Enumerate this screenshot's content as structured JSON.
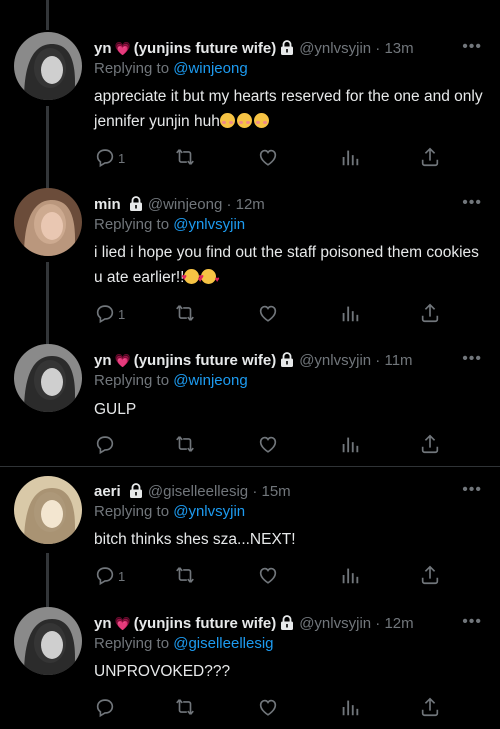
{
  "tweets": [
    {
      "name": "yn",
      "display_suffix": "(yunjins future wife)",
      "has_heart": true,
      "handle": "@ynlvsyjin",
      "time": "13m",
      "replying_prefix": "Replying to",
      "replying_to": "@winjeong",
      "text": "appreciate it but my hearts reserved for the one and only jennifer yunjin huh",
      "emojis": [
        "blush",
        "blush",
        "blush"
      ],
      "reply_count": "1"
    },
    {
      "name": "min",
      "display_suffix": "",
      "has_heart": false,
      "handle": "@winjeong",
      "time": "12m",
      "replying_prefix": "Replying to",
      "replying_to": "@ynlvsyjin",
      "text": "i lied i hope you find out the staff poisoned them cookies u ate earlier!!",
      "emojis": [
        "love",
        "love"
      ],
      "reply_count": "1"
    },
    {
      "name": "yn",
      "display_suffix": "(yunjins future wife)",
      "has_heart": true,
      "handle": "@ynlvsyjin",
      "time": "11m",
      "replying_prefix": "Replying to",
      "replying_to": "@winjeong",
      "text": "GULP",
      "emojis": [],
      "reply_count": ""
    },
    {
      "name": "aeri",
      "display_suffix": "",
      "has_heart": false,
      "handle": "@giselleellesig",
      "time": "15m",
      "replying_prefix": "Replying to",
      "replying_to": "@ynlvsyjin",
      "text": "bitch thinks shes sza...NEXT!",
      "emojis": [],
      "reply_count": "1"
    },
    {
      "name": "yn",
      "display_suffix": "(yunjins future wife)",
      "has_heart": true,
      "handle": "@ynlvsyjin",
      "time": "12m",
      "replying_prefix": "Replying to",
      "replying_to": "@giselleellesig",
      "text": "UNPROVOKED???",
      "emojis": [],
      "reply_count": ""
    }
  ],
  "icons": {
    "reply": "reply-icon",
    "retweet": "retweet-icon",
    "like": "like-icon",
    "views": "views-icon",
    "share": "share-icon",
    "more": "more-icon",
    "lock": "lock-icon"
  },
  "colors": {
    "background": "#000000",
    "text": "#e7e9ea",
    "muted": "#71767b",
    "link": "#1d9bf0",
    "heart": "#f0589c"
  }
}
